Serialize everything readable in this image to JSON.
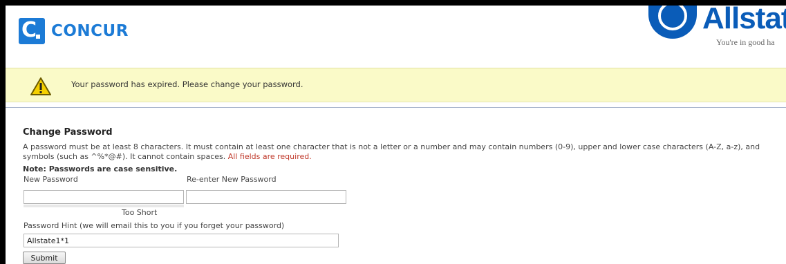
{
  "header": {
    "brand": "CONCUR",
    "partner_name": "Allstate",
    "partner_tagline": "You're in good ha"
  },
  "alert": {
    "message": "Your password has expired. Please change your password."
  },
  "form": {
    "title": "Change Password",
    "rules_text": "A password must be at least 8 characters. It must contain at least one character that is not a letter or a number and may contain numbers (0-9), upper and lower case characters (A-Z, a-z), and symbols (such as ^%*@#). It cannot contain spaces. ",
    "required_text": "All fields are required.",
    "note": "Note: Passwords are case sensitive.",
    "new_password_label": "New Password",
    "new_password_value": "",
    "reenter_password_label": "Re-enter New Password",
    "reenter_password_value": "",
    "strength_text": "Too Short",
    "strength_level": 0,
    "hint_label": "Password Hint (we will email this to you if you forget your password)",
    "hint_value": "Allstate1*1",
    "submit_label": "Submit"
  },
  "colors": {
    "concur_blue": "#1c7bd6",
    "allstate_blue": "#0a5cb8",
    "alert_background": "#fafac8",
    "required_red": "#c0392b"
  },
  "icons": {
    "warning": "warning-icon"
  }
}
